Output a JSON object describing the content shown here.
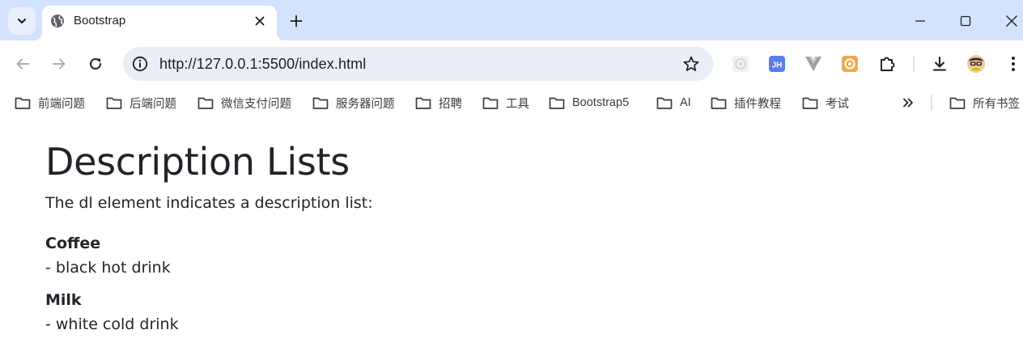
{
  "browser": {
    "tab": {
      "title": "Bootstrap",
      "favicon": "globe-icon"
    },
    "address": {
      "url": "http://127.0.0.1:5500/index.html"
    },
    "extensions": [
      "ext-faded-icon",
      "jh-extension-icon",
      "vue-devtools-icon",
      "orange-extension-icon",
      "puzzle-icon"
    ],
    "ext_jh_label": "JH",
    "bookmarks": [
      {
        "label": "前端问题"
      },
      {
        "label": "后端问题"
      },
      {
        "label": "微信支付问题"
      },
      {
        "label": "服务器问题"
      },
      {
        "label": "招聘"
      },
      {
        "label": "工具"
      },
      {
        "label": "Bootstrap5"
      },
      {
        "label": "AI"
      },
      {
        "label": "插件教程"
      },
      {
        "label": "考试"
      }
    ],
    "all_bookmarks_label": "所有书签",
    "colors": {
      "tabstrip": "#d3e3fd",
      "omnibox": "#e9eef6",
      "text": "#1f1f1f"
    }
  },
  "page": {
    "title": "Description Lists",
    "intro": "The dl element indicates a description list:",
    "items": [
      {
        "term": "Coffee",
        "desc": "- black hot drink"
      },
      {
        "term": "Milk",
        "desc": "- white cold drink"
      }
    ],
    "text_color": "#212529"
  }
}
